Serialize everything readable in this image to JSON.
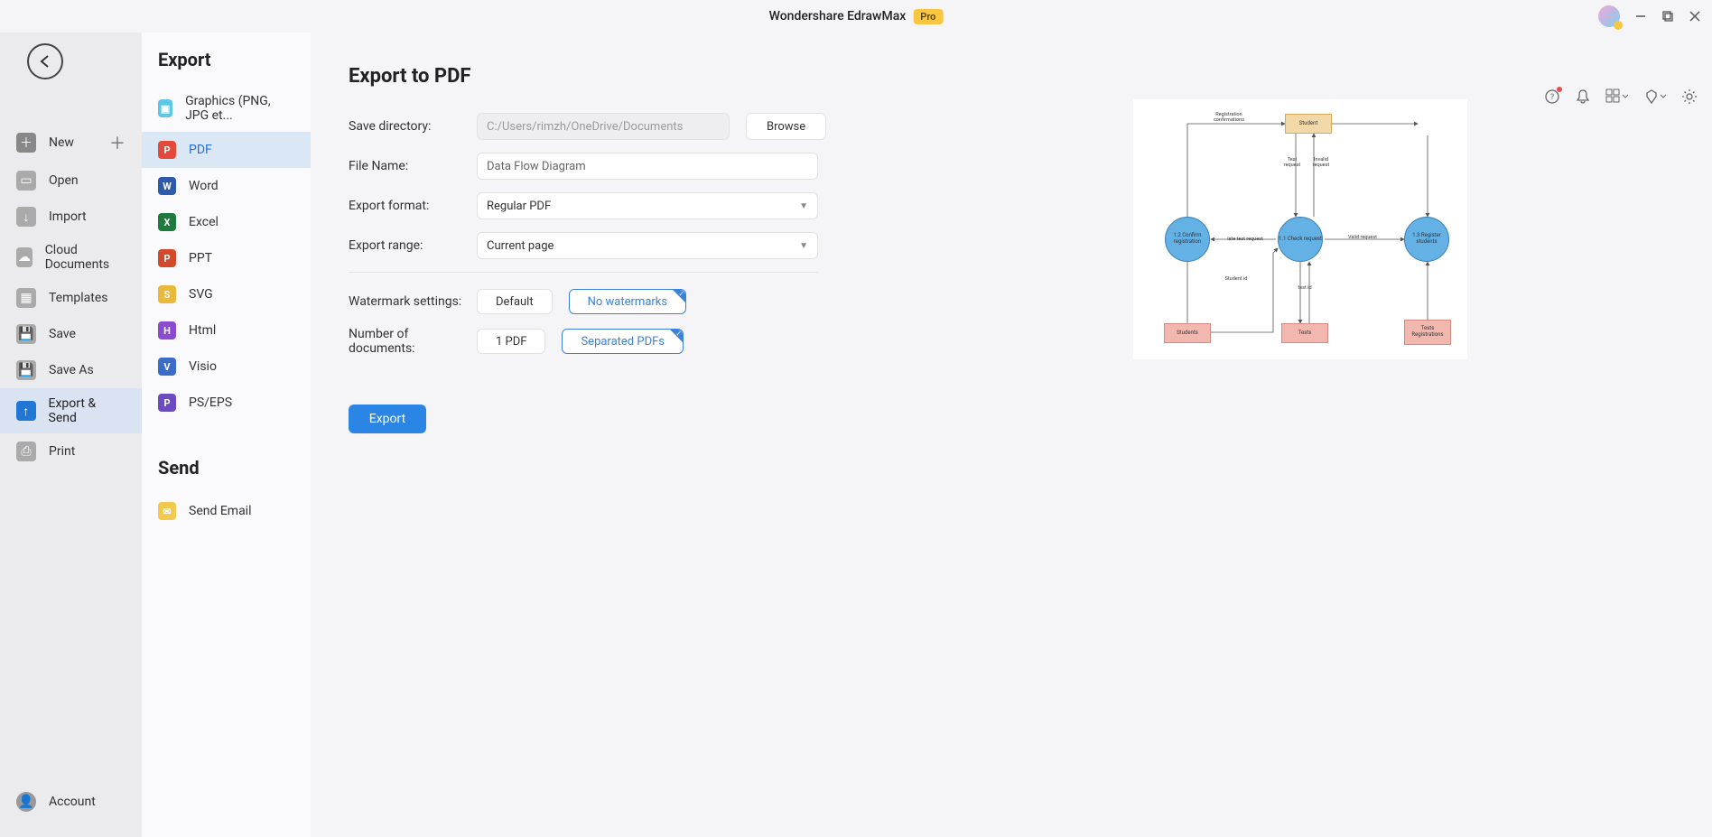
{
  "titlebar": {
    "app_name": "Wondershare EdrawMax",
    "badge": "Pro"
  },
  "sidebar": {
    "items": [
      {
        "label": "New"
      },
      {
        "label": "Open"
      },
      {
        "label": "Import"
      },
      {
        "label": "Cloud Documents"
      },
      {
        "label": "Templates"
      },
      {
        "label": "Save"
      },
      {
        "label": "Save As"
      },
      {
        "label": "Export & Send"
      },
      {
        "label": "Print"
      }
    ],
    "account": "Account"
  },
  "export_panel": {
    "heading": "Export",
    "items": [
      {
        "label": "Graphics (PNG, JPG et..."
      },
      {
        "label": "PDF"
      },
      {
        "label": "Word"
      },
      {
        "label": "Excel"
      },
      {
        "label": "PPT"
      },
      {
        "label": "SVG"
      },
      {
        "label": "Html"
      },
      {
        "label": "Visio"
      },
      {
        "label": "PS/EPS"
      }
    ],
    "send_heading": "Send",
    "send_item": "Send Email"
  },
  "form": {
    "title": "Export to PDF",
    "save_dir_label": "Save directory:",
    "save_dir_value": "C:/Users/rimzh/OneDrive/Documents",
    "browse": "Browse",
    "file_name_label": "File Name:",
    "file_name_value": "Data Flow Diagram",
    "format_label": "Export format:",
    "format_value": "Regular PDF",
    "range_label": "Export range:",
    "range_value": "Current page",
    "watermark_label": "Watermark settings:",
    "watermark_default": "Default",
    "watermark_none": "No watermarks",
    "numdocs_label": "Number of documents:",
    "numdocs_one": "1 PDF",
    "numdocs_sep": "Separated PDFs",
    "export_btn": "Export"
  },
  "preview": {
    "nodes": {
      "student": "Student",
      "confirm": "1.2 Confirm registration",
      "check": "1.1 Check request",
      "register": "1.3 Register students",
      "students_ds": "Students",
      "tests_ds": "Tests",
      "tests_reg_ds": "Tests Registrations"
    },
    "labels": {
      "reg_conf": "Registration confirmations",
      "test_req": "Test request",
      "invalid_req": "Invalid request",
      "latetest_req": "late test request",
      "valid_req": "Valid request",
      "student_id": "Student id",
      "test_id": "test id"
    }
  }
}
